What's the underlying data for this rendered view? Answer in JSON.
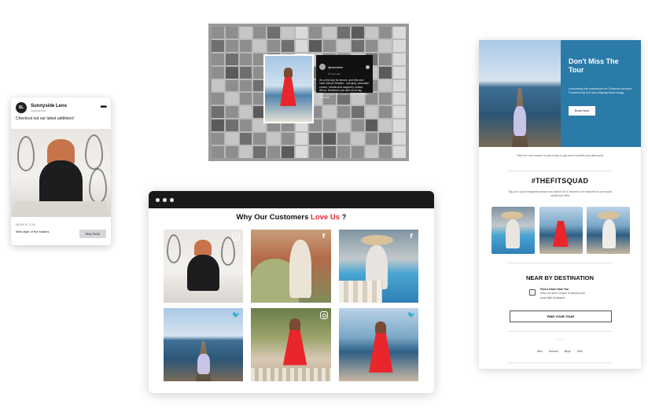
{
  "ad": {
    "avatar_initials": "SL",
    "brand": "Sunnyside Lens",
    "sponsored": "Sponsored",
    "menu": "•••",
    "caption": "Checkout out our latest additions!",
    "site": "WEBSITE.COM",
    "description": "New style of the shades",
    "buy_label": "Buy Now"
  },
  "collage": {
    "post_user": "@username",
    "post_handle": "2 hours ago",
    "post_text": "It's a fine day for lenses, and this new look! Deluxe Shades - soft grey, chocolate combo, rubella and raspberry combo. Whoa. Newborns are with us all day sipping glass and Kristen shares Glasses. Skincare."
  },
  "email": {
    "hero_title": "Don't Miss The Tour",
    "hero_text": "Launching the adventure for Summer season. Powered by the new display technology.",
    "hero_button": "Book Now",
    "note": "Take the next chance to join today to get more benefits and discounts",
    "hashtag": "#THEFITSQUAD",
    "hashtag_sub": "Tag us in your Instagram photos and videos for a chance to be featured on our social media and WIN",
    "near_title": "NEAR BY DESTINATION",
    "store_title": "Find a Store Near You",
    "store_text": "View our store locator to access your local Nike boutiques",
    "find_button": "FIND YOUR TOUR",
    "dots": "— — —",
    "footer_links": [
      "Men",
      "Women",
      "Boys",
      "Girls"
    ]
  },
  "widget": {
    "dots": [
      "•",
      "•",
      "•"
    ],
    "title_prefix": "Why Our Customers ",
    "title_highlight": "Love Us",
    "title_suffix": " ?",
    "posts": [
      {
        "source": "instagram-icon",
        "scene": "bed"
      },
      {
        "source": "facebook-icon",
        "scene": "car"
      },
      {
        "source": "facebook-icon",
        "scene": "pool"
      },
      {
        "source": "twitter-icon",
        "scene": "pier"
      },
      {
        "source": "instagram-icon",
        "scene": "garden"
      },
      {
        "source": "twitter-icon",
        "scene": "coast"
      }
    ]
  },
  "colors": {
    "accent_red": "#e5262b",
    "email_blue": "#2b7ba8",
    "browser_bar": "#1a1a1a"
  }
}
